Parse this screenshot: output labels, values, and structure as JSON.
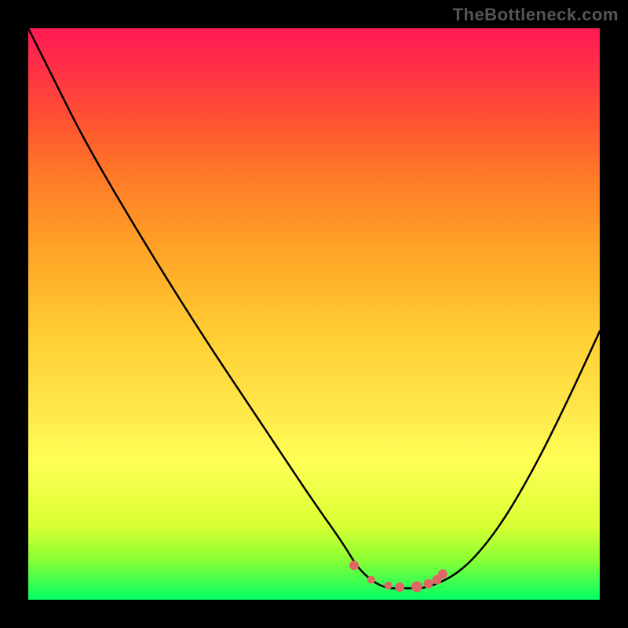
{
  "watermark": "TheBottleneck.com",
  "chart_data": {
    "type": "line",
    "title": "",
    "xlabel": "",
    "ylabel": "",
    "xlim": [
      0,
      100
    ],
    "ylim": [
      0,
      100
    ],
    "series": [
      {
        "name": "curve",
        "color": "#000000",
        "x": [
          0,
          4,
          10,
          20,
          30,
          40,
          50,
          55,
          58,
          62,
          66,
          70,
          76,
          82,
          88,
          94,
          100
        ],
        "y": [
          100,
          92,
          80,
          63,
          47,
          32,
          17,
          10,
          5,
          2,
          2,
          2,
          5,
          12,
          22,
          34,
          47
        ]
      }
    ],
    "highlight": {
      "name": "sweet-spot",
      "color": "#e06666",
      "points": [
        {
          "x": 57,
          "y": 6,
          "r": 6
        },
        {
          "x": 60,
          "y": 3.5,
          "r": 5
        },
        {
          "x": 63,
          "y": 2.5,
          "r": 5
        },
        {
          "x": 65,
          "y": 2.2,
          "r": 6
        },
        {
          "x": 68,
          "y": 2.3,
          "r": 7
        },
        {
          "x": 70,
          "y": 2.8,
          "r": 6
        },
        {
          "x": 71.5,
          "y": 3.5,
          "r": 6
        },
        {
          "x": 72.5,
          "y": 4.5,
          "r": 6
        }
      ]
    },
    "gradient_stops": [
      {
        "pos": 0,
        "color": "#00ff66"
      },
      {
        "pos": 7,
        "color": "#8aff33"
      },
      {
        "pos": 13,
        "color": "#d9ff33"
      },
      {
        "pos": 24,
        "color": "#ffff55"
      },
      {
        "pos": 33,
        "color": "#ffe84a"
      },
      {
        "pos": 47,
        "color": "#ffcc33"
      },
      {
        "pos": 62,
        "color": "#ffa126"
      },
      {
        "pos": 74,
        "color": "#ff7a28"
      },
      {
        "pos": 83,
        "color": "#ff5630"
      },
      {
        "pos": 92,
        "color": "#ff3344"
      },
      {
        "pos": 100,
        "color": "#ff1a55"
      }
    ]
  }
}
